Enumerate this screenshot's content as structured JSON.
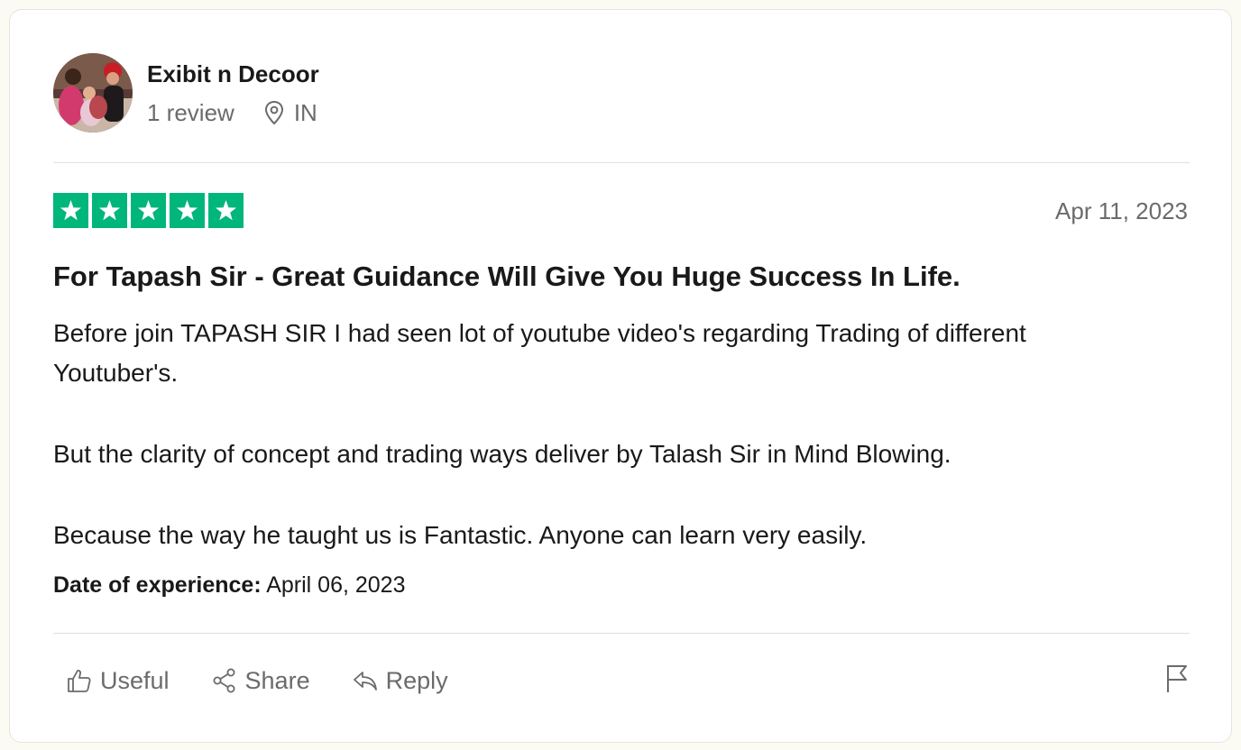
{
  "reviewer": {
    "name": "Exibit n Decoor",
    "review_count": "1 review",
    "country": "IN"
  },
  "review": {
    "rating": 5,
    "date": "Apr 11, 2023",
    "title": "For Tapash Sir - Great Guidance Will Give You Huge Success In Life.",
    "paragraphs": [
      "Before join TAPASH SIR I had seen lot of youtube video's regarding Trading of different Youtuber's.",
      "But the clarity of concept and trading ways deliver by Talash Sir in Mind Blowing.",
      "Because the way he taught us is Fantastic. Anyone can learn very easily."
    ],
    "experience_label": "Date of experience:",
    "experience_date": "April 06, 2023"
  },
  "actions": {
    "useful_label": "Useful",
    "share_label": "Share",
    "reply_label": "Reply"
  },
  "colors": {
    "star_green": "#00b67a",
    "muted_text": "#6b6b6b",
    "body_text": "#191919"
  },
  "icons": {
    "location": "location-pin-icon",
    "useful": "thumbs-up-icon",
    "share": "share-icon",
    "reply": "reply-icon",
    "report": "flag-icon",
    "star": "star-icon"
  }
}
